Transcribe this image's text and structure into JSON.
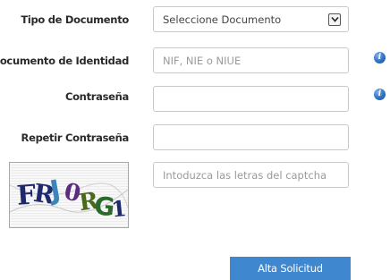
{
  "form": {
    "tipo_documento": {
      "label": "Tipo de Documento",
      "selected": "Seleccione Documento"
    },
    "documento_identidad": {
      "label": "Documento de Identidad",
      "placeholder": "NIF, NIE o NIUE",
      "value": ""
    },
    "contrasena": {
      "label": "Contraseña",
      "value": ""
    },
    "repetir_contrasena": {
      "label": "Repetir Contraseña",
      "value": ""
    },
    "captcha": {
      "placeholder": "Intoduzca las letras del captcha",
      "value": "",
      "image_text": "FRJ0RG1"
    },
    "submit_label": "Alta Solicitud"
  },
  "icons": {
    "info": "info-icon",
    "dropdown": "chevron-down-icon"
  },
  "colors": {
    "accent": "#3f87cf",
    "info": "#2f6fc4"
  }
}
